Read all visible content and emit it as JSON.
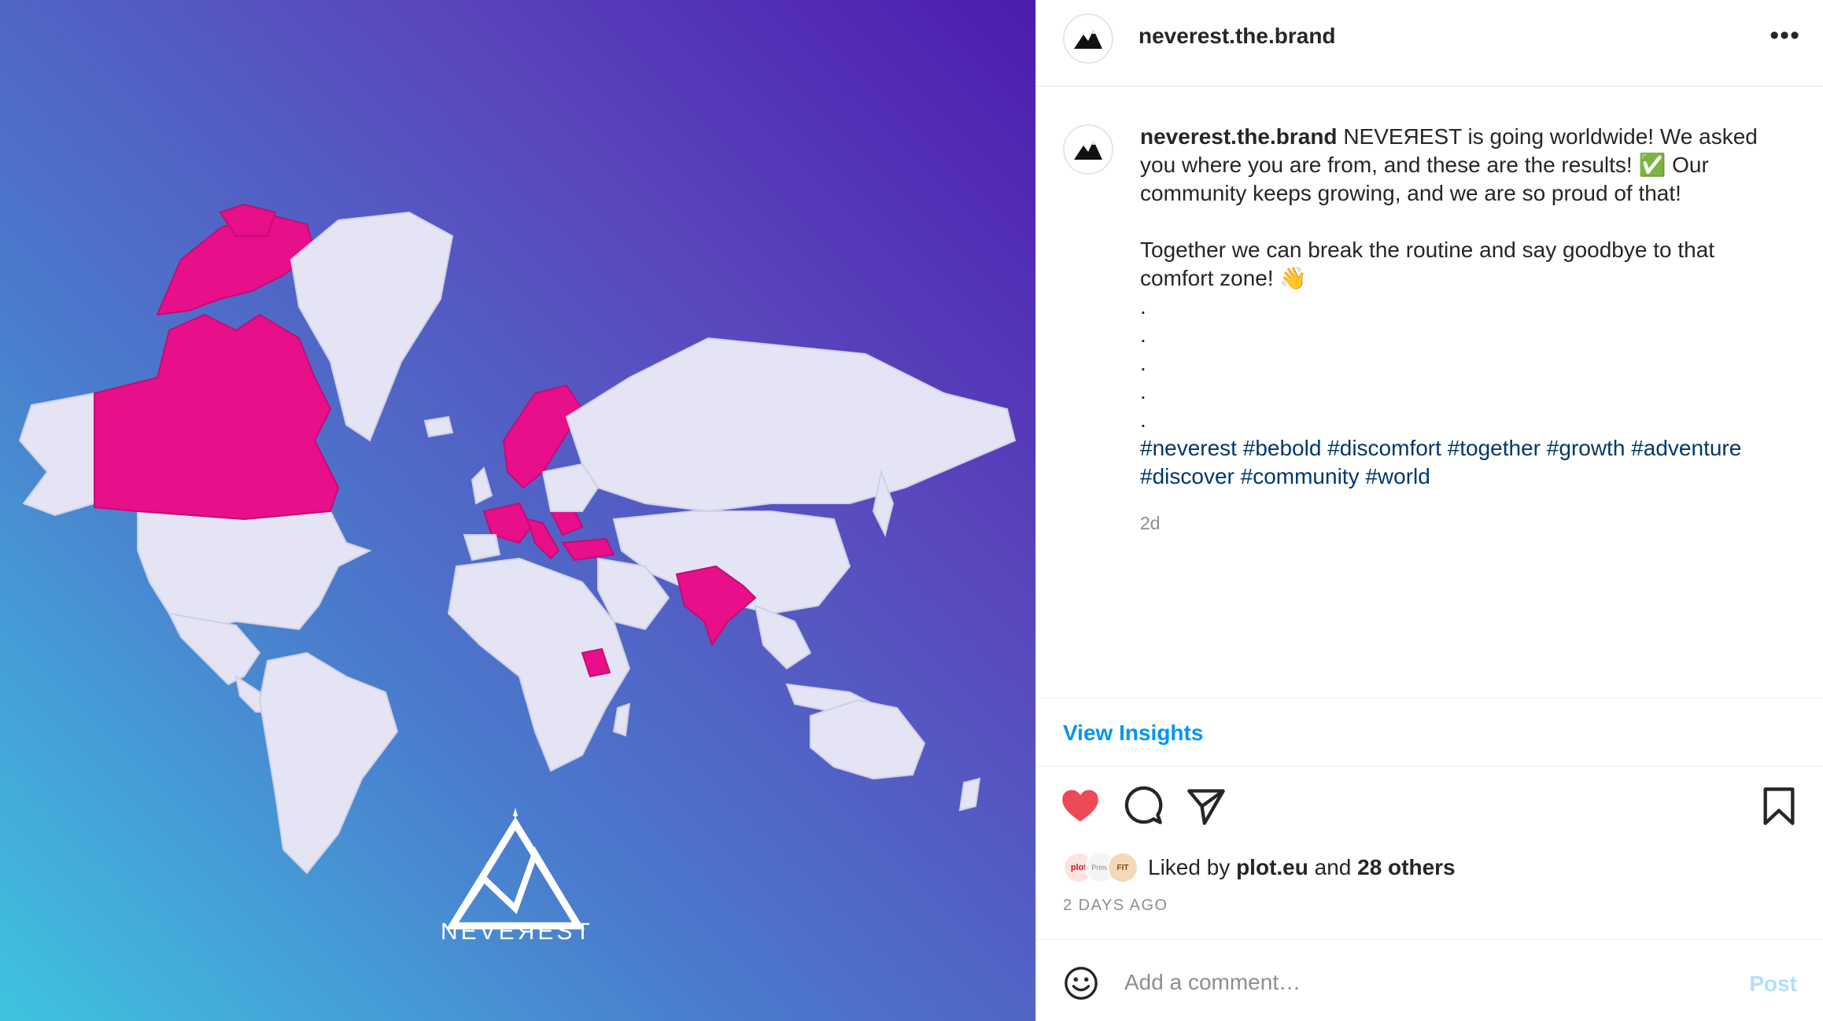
{
  "post": {
    "username": "neverest.the.brand",
    "image": {
      "logo_text": "NEVEЯEST",
      "map_highlight_color": "#e80f8a",
      "map_land_color": "#e4e4f4"
    },
    "menu_icon": "more-horizontal-icon",
    "caption": {
      "username": "neverest.the.brand",
      "line1": "NEVEЯEST is going worldwide! We asked you where you are from, and these are the results! ✅ Our community keeps growing, and we are so proud of that!",
      "line2": "Together we can break the routine and say goodbye to that comfort zone! 👋",
      "dots": [
        ".",
        ".",
        ".",
        ".",
        "."
      ],
      "hashtags": [
        "#neverest",
        "#bebold",
        "#discomfort",
        "#together",
        "#growth",
        "#adventure",
        "#discover",
        "#community",
        "#world"
      ]
    },
    "age": "2d",
    "insights_label": "View Insights",
    "actions": [
      "heart-icon",
      "comment-icon",
      "share-icon",
      "bookmark-icon"
    ],
    "liked": true,
    "likes": {
      "prefix": "Liked by",
      "first_user": "plot.eu",
      "connector": "and",
      "others": "28 others",
      "avatar_labels": [
        "plot",
        "Prima",
        "FIT"
      ]
    },
    "timestamp": "2 DAYS AGO",
    "comment": {
      "placeholder": "Add a comment…",
      "post_label": "Post"
    },
    "colors": {
      "link_blue": "#0095f6",
      "hashtag_blue": "#00376b",
      "like_red": "#ed4956",
      "post_disabled": "#b2dffc"
    }
  }
}
